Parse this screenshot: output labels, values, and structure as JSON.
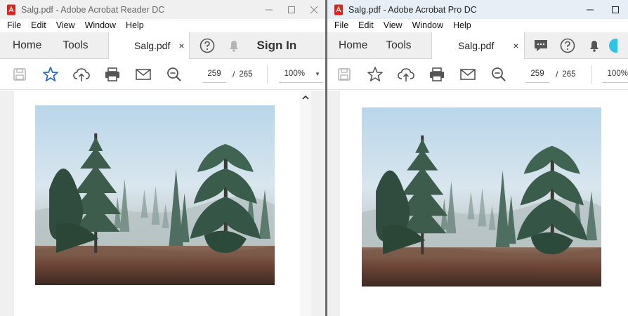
{
  "left_window": {
    "title": "Salg.pdf - Adobe Acrobat Reader DC",
    "menu": [
      "File",
      "Edit",
      "View",
      "Window",
      "Help"
    ],
    "tabs": {
      "home": "Home",
      "tools": "Tools",
      "file": "Salg.pdf",
      "close": "×"
    },
    "sign_in": "Sign In",
    "page_current": "259",
    "page_sep": "/",
    "page_total": "265",
    "zoom": "100%"
  },
  "right_window": {
    "title": "Salg.pdf - Adobe Acrobat Pro DC",
    "menu": [
      "File",
      "Edit",
      "View",
      "Window",
      "Help"
    ],
    "tabs": {
      "home": "Home",
      "tools": "Tools",
      "file": "Salg.pdf",
      "close": "×"
    },
    "page_current": "259",
    "page_sep": "/",
    "page_total": "265",
    "zoom": "100%"
  },
  "colors": {
    "accent_blue": "#2b6bd2",
    "pdf_red": "#d9261c",
    "icon_gray": "#555555",
    "disabled_gray": "#b5b5b5"
  },
  "icons": [
    "pdf-file-icon",
    "minimize-icon",
    "maximize-icon",
    "close-icon",
    "help-icon",
    "bell-icon",
    "comment-icon",
    "save-icon",
    "star-icon",
    "upload-cloud-icon",
    "print-icon",
    "mail-icon",
    "zoom-search-icon",
    "chevron-down-icon",
    "chevron-up-icon"
  ]
}
